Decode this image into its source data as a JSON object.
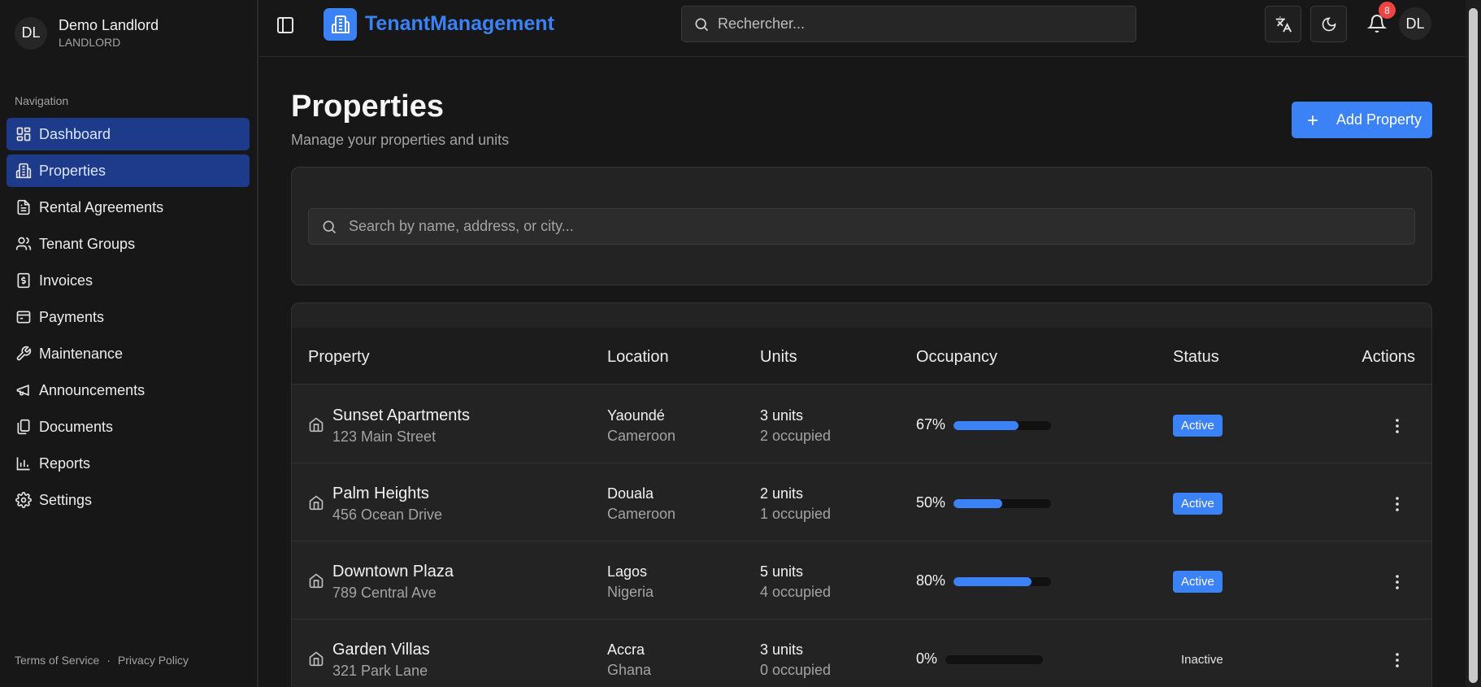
{
  "sidebar": {
    "user": {
      "initials": "DL",
      "name": "Demo Landlord",
      "role": "LANDLORD"
    },
    "nav_heading": "Navigation",
    "items": [
      {
        "label": "Dashboard",
        "icon": "layout-grid-icon",
        "active": true
      },
      {
        "label": "Properties",
        "icon": "building-icon",
        "active": true
      },
      {
        "label": "Rental Agreements",
        "icon": "document-icon",
        "active": false
      },
      {
        "label": "Tenant Groups",
        "icon": "users-icon",
        "active": false
      },
      {
        "label": "Invoices",
        "icon": "dollar-receipt-icon",
        "active": false
      },
      {
        "label": "Payments",
        "icon": "wallet-icon",
        "active": false
      },
      {
        "label": "Maintenance",
        "icon": "wrench-icon",
        "active": false
      },
      {
        "label": "Announcements",
        "icon": "megaphone-icon",
        "active": false
      },
      {
        "label": "Documents",
        "icon": "files-icon",
        "active": false
      },
      {
        "label": "Reports",
        "icon": "bar-chart-icon",
        "active": false
      },
      {
        "label": "Settings",
        "icon": "gear-icon",
        "active": false
      }
    ],
    "footer": {
      "terms": "Terms of Service",
      "separator": "·",
      "privacy": "Privacy Policy"
    }
  },
  "header": {
    "app_name": "TenantManagement",
    "search_placeholder": "Rechercher...",
    "notification_count": "8",
    "avatar_initials": "DL"
  },
  "page": {
    "title": "Properties",
    "subtitle": "Manage your properties and units",
    "add_button": "Add Property",
    "search_placeholder": "Search by name, address, or city..."
  },
  "table": {
    "columns": [
      "Property",
      "Location",
      "Units",
      "Occupancy",
      "Status",
      "Actions"
    ],
    "rows": [
      {
        "name": "Sunset Apartments",
        "address": "123 Main Street",
        "city": "Yaoundé",
        "country": "Cameroon",
        "units": "3 units",
        "occupied": "2 occupied",
        "occupancy": "67%",
        "occupancy_value": 0.67,
        "status": "Active"
      },
      {
        "name": "Palm Heights",
        "address": "456 Ocean Drive",
        "city": "Douala",
        "country": "Cameroon",
        "units": "2 units",
        "occupied": "1 occupied",
        "occupancy": "50%",
        "occupancy_value": 0.5,
        "status": "Active"
      },
      {
        "name": "Downtown Plaza",
        "address": "789 Central Ave",
        "city": "Lagos",
        "country": "Nigeria",
        "units": "5 units",
        "occupied": "4 occupied",
        "occupancy": "80%",
        "occupancy_value": 0.8,
        "status": "Active"
      },
      {
        "name": "Garden Villas",
        "address": "321 Park Lane",
        "city": "Accra",
        "country": "Ghana",
        "units": "3 units",
        "occupied": "0 occupied",
        "occupancy": "0%",
        "occupancy_value": 0,
        "status": "Inactive"
      }
    ]
  },
  "colors": {
    "accent": "#3b82f6",
    "nav_active_bg": "#1e3a8a",
    "badge_red": "#ef4444",
    "background": "#171717"
  }
}
